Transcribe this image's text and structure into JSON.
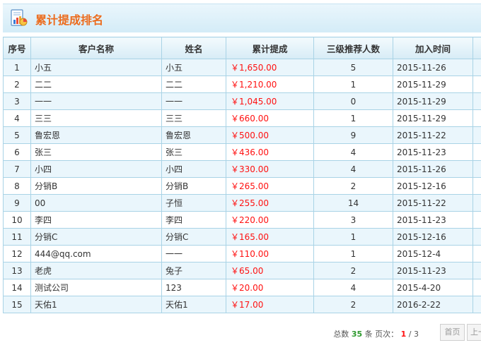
{
  "header": {
    "title": "累计提成排名"
  },
  "table": {
    "columns": [
      "序号",
      "客户名称",
      "姓名",
      "累计提成",
      "三级推荐人数",
      "加入时间"
    ],
    "rows": [
      {
        "index": "1",
        "customer": "小五",
        "name": "小五",
        "commission": "￥1,650.00",
        "referrals": "5",
        "joined": "2015-11-26"
      },
      {
        "index": "2",
        "customer": "二二",
        "name": "二二",
        "commission": "￥1,210.00",
        "referrals": "1",
        "joined": "2015-11-29"
      },
      {
        "index": "3",
        "customer": "一一",
        "name": "一一",
        "commission": "￥1,045.00",
        "referrals": "0",
        "joined": "2015-11-29"
      },
      {
        "index": "4",
        "customer": "三三",
        "name": "三三",
        "commission": "￥660.00",
        "referrals": "1",
        "joined": "2015-11-29"
      },
      {
        "index": "5",
        "customer": "鲁宏恩",
        "name": "鲁宏恩",
        "commission": "￥500.00",
        "referrals": "9",
        "joined": "2015-11-22"
      },
      {
        "index": "6",
        "customer": "张三",
        "name": "张三",
        "commission": "￥436.00",
        "referrals": "4",
        "joined": "2015-11-23"
      },
      {
        "index": "7",
        "customer": "小四",
        "name": "小四",
        "commission": "￥330.00",
        "referrals": "4",
        "joined": "2015-11-26"
      },
      {
        "index": "8",
        "customer": "分销B",
        "name": "分销B",
        "commission": "￥265.00",
        "referrals": "2",
        "joined": "2015-12-16"
      },
      {
        "index": "9",
        "customer": "00",
        "name": "子恒",
        "commission": "￥255.00",
        "referrals": "14",
        "joined": "2015-11-22"
      },
      {
        "index": "10",
        "customer": "李四",
        "name": "李四",
        "commission": "￥220.00",
        "referrals": "3",
        "joined": "2015-11-23"
      },
      {
        "index": "11",
        "customer": "分销C",
        "name": "分销C",
        "commission": "￥165.00",
        "referrals": "1",
        "joined": "2015-12-16"
      },
      {
        "index": "12",
        "customer": "444@qq.com",
        "name": "一一",
        "commission": "￥110.00",
        "referrals": "1",
        "joined": "2015-12-4"
      },
      {
        "index": "13",
        "customer": "老虎",
        "name": "兔子",
        "commission": "￥65.00",
        "referrals": "2",
        "joined": "2015-11-23"
      },
      {
        "index": "14",
        "customer": "测试公司",
        "name": "123",
        "commission": "￥20.00",
        "referrals": "4",
        "joined": "2015-4-20"
      },
      {
        "index": "15",
        "customer": "天佑1",
        "name": "天佑1",
        "commission": "￥17.00",
        "referrals": "2",
        "joined": "2016-2-22"
      }
    ]
  },
  "pager": {
    "total_label": "总数",
    "total": "35",
    "items_label": "条 页次：",
    "current": "1",
    "sep": "/",
    "pages": "3",
    "first_label": "首页",
    "prev_label": "上一"
  },
  "colors": {
    "accent": "#ec6b1c",
    "money": "#ff1111",
    "border": "#a9d3e6",
    "row_alt": "#eaf6fc"
  },
  "icons": {
    "title": "report-chart-icon"
  }
}
